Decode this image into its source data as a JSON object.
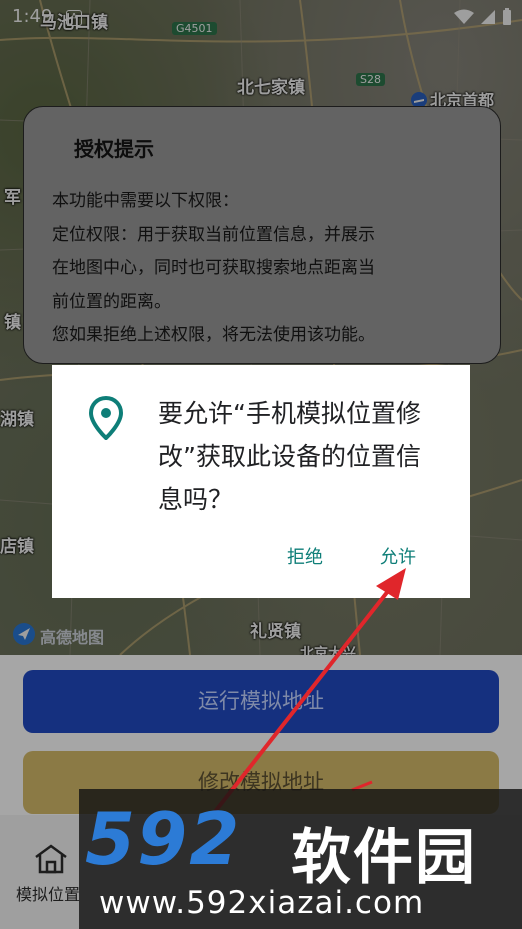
{
  "status_bar": {
    "time": "1:49",
    "badge": "A"
  },
  "map": {
    "labels": [
      "马池口镇",
      "北七家镇",
      "北京首都",
      "军",
      "镇",
      "湖镇",
      "店镇",
      "礼贤镇",
      "北京大兴"
    ],
    "roads": [
      "G4501",
      "S28"
    ],
    "logo_text": "高德地图"
  },
  "auth_dialog": {
    "title": "授权提示",
    "lines": [
      "本功能中需要以下权限：",
      "定位权限：用于获取当前位置信息，并展示",
      "在地图中心，同时也可获取搜索地点距离当",
      "前位置的距离。",
      "您如果拒绝上述权限，将无法使用该功能。"
    ]
  },
  "permission_dialog": {
    "message": "要允许“手机模拟位置修改”获取此设备的位置信息吗？",
    "deny": "拒绝",
    "allow": "允许",
    "accent": "#0e7e78"
  },
  "buttons": {
    "run": "运行模拟地址",
    "modify": "修改模拟地址"
  },
  "nav": {
    "home_label": "模拟位置"
  },
  "watermark": {
    "number": "592",
    "brand": "软件园",
    "url": "www.592xiazai.com"
  }
}
